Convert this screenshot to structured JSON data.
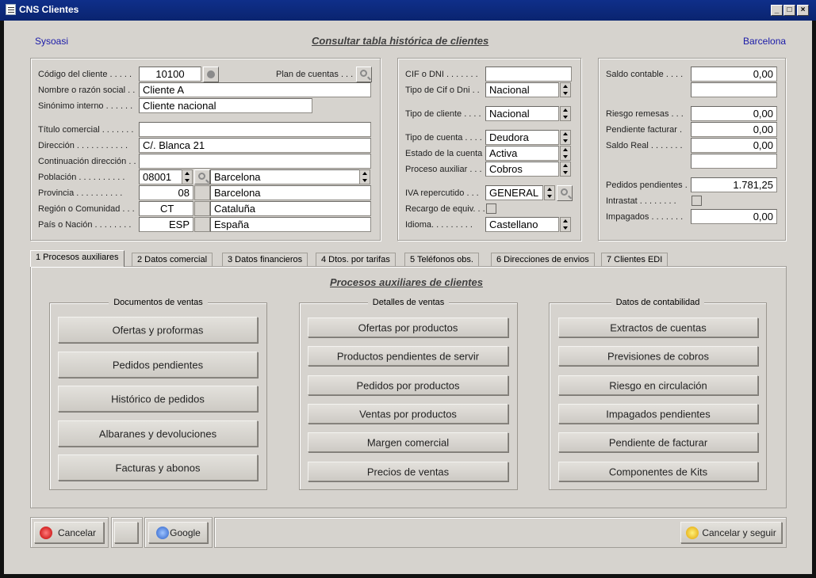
{
  "window": {
    "title": "CNS Clientes",
    "controls": [
      "_",
      "□",
      "×"
    ]
  },
  "header": {
    "left": "Sysoasi",
    "title": "Consultar tabla histórica de clientes",
    "right": "Barcelona"
  },
  "cliente": {
    "codigo_label": "Código del cliente . . . . .",
    "codigo": "10100",
    "plan_label": "Plan de cuentas . . .",
    "nombre_label": "Nombre o razón social . .",
    "nombre": "Cliente A",
    "sinonimo_label": "Sinónimo interno . . . . . .",
    "sinonimo": "Cliente nacional",
    "titulo_label": "Título comercial . . . . . . .",
    "titulo": "",
    "direccion_label": "Dirección . . . . . . . . . . .",
    "direccion": "C/. Blanca 21",
    "continuacion_label": "Continuación dirección . .",
    "continuacion": "",
    "poblacion_label": "Población . . . . . . . . . .",
    "cp": "08001",
    "poblacion": "Barcelona",
    "provincia_label": "Provincia . . . . . . . . . .",
    "provincia_code": "08",
    "provincia": "Barcelona",
    "region_label": "Región o Comunidad . . .",
    "region_code": "CT",
    "region": "Cataluña",
    "pais_label": "País o Nación . . . . . . . .",
    "pais_code": "ESP",
    "pais": "España"
  },
  "fiscal": {
    "cif_label": "CIF o DNI . . . . . . .",
    "cif": "",
    "tipo_cif_label": "Tipo de Cif o Dni . .",
    "tipo_cif": "Nacional",
    "tipo_cliente_label": "Tipo de cliente . . . .",
    "tipo_cliente": "Nacional",
    "tipo_cuenta_label": "Tipo de cuenta . . . .",
    "tipo_cuenta": "Deudora",
    "estado_label": "Estado de la cuenta .",
    "estado": "Activa",
    "proceso_label": "Proceso auxiliar . . .",
    "proceso": "Cobros",
    "iva_label": "IVA repercutido . . .",
    "iva": "GENERAL",
    "recargo_label": "Recargo de equiv. . .",
    "idioma_label": "Idioma. . . . . . . . .",
    "idioma": "Castellano"
  },
  "saldos": {
    "saldo_contable_label": "Saldo contable . . . .",
    "saldo_contable": "0,00",
    "riesgo_label": "Riesgo remesas . . .",
    "riesgo": "0,00",
    "pendiente_label": "Pendiente facturar .",
    "pendiente": "0,00",
    "saldo_real_label": "Saldo Real . . . . . . .",
    "saldo_real": "0,00",
    "pedidos_label": "Pedidos pendientes .",
    "pedidos": "1.781,25",
    "intrastat_label": "Intrastat . . . . . . . .",
    "impagados_label": "Impagados . . . . . . .",
    "impagados": "0,00"
  },
  "tabs": [
    "1 Procesos auxiliares",
    "2 Datos comercial",
    "3 Datos financieros",
    "4 Dtos. por tarifas",
    "5 Teléfonos obs.",
    "6 Direcciones de envios",
    "7 Clientes EDI"
  ],
  "panel": {
    "title": "Procesos auxiliares de clientes",
    "groups": [
      {
        "caption": "Documentos de ventas",
        "buttons": [
          "Ofertas y proformas",
          "Pedidos pendientes",
          "Histórico de pedidos",
          "Albaranes y devoluciones",
          "Facturas y abonos"
        ]
      },
      {
        "caption": "Detalles de ventas",
        "buttons": [
          "Ofertas por productos",
          "Productos pendientes de servir",
          "Pedidos por productos",
          "Ventas por productos",
          "Margen comercial",
          "Precios de ventas"
        ]
      },
      {
        "caption": "Datos de contabilidad",
        "buttons": [
          "Extractos de cuentas",
          "Previsiones de cobros",
          "Riesgo en circulación",
          "Impagados pendientes",
          "Pendiente de facturar",
          "Componentes de Kits"
        ]
      }
    ]
  },
  "footer": {
    "cancelar": "Cancelar",
    "google": "Google",
    "cancelar_seguir": "Cancelar y seguir"
  }
}
